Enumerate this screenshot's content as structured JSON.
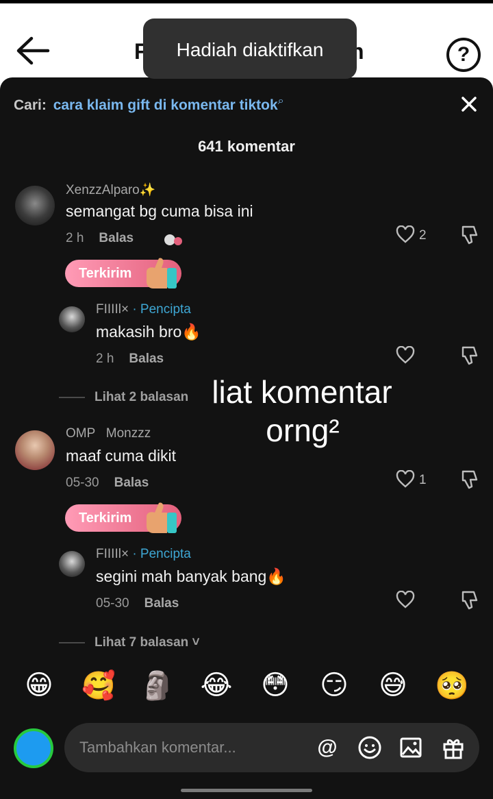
{
  "header": {
    "title_left_fragment": "F",
    "title_right_fragment": "n"
  },
  "toast": {
    "text": "Hadiah diaktifkan"
  },
  "search": {
    "prefix": "Cari:",
    "query": "cara klaim gift di komentar tiktok"
  },
  "comment_count": "641 komentar",
  "comments": [
    {
      "username": "XenzzAlparo✨",
      "text": "semangat bg  cuma bisa ini",
      "time": "2 h",
      "reply_label": "Balas",
      "likes": "2",
      "gift_label": "Terkirim"
    },
    {
      "username": "FIIIIl×",
      "creator_tag": "· Pencipta",
      "text": "makasih bro🔥",
      "time": "2 h",
      "reply_label": "Balas",
      "likes": ""
    },
    {
      "username": "OMP   Monzzz",
      "text": "maaf cuma dikit",
      "time": "05-30",
      "reply_label": "Balas",
      "likes": "1",
      "gift_label": "Terkirim"
    },
    {
      "username": "FIIIIl×",
      "creator_tag": "· Pencipta",
      "text": "segini mah banyak bang🔥",
      "time": "05-30",
      "reply_label": "Balas",
      "likes": ""
    }
  ],
  "view_replies": [
    "Lihat 2 balasan",
    "Lihat 7 balasan ˅"
  ],
  "overlay_text": {
    "line1": "liat komentar",
    "line2": "orng²"
  },
  "emoji_bar": [
    "😁",
    "🥰",
    "🗿",
    "😂",
    "😳",
    "😏",
    "😅",
    "🥺"
  ],
  "composer": {
    "placeholder": "Tambahkan komentar...",
    "mention_symbol": "@"
  },
  "icons": [
    "back-arrow-icon",
    "help-icon",
    "search-icon",
    "close-icon",
    "heart-icon",
    "dislike-icon",
    "thumbs-up-icon",
    "emoji-icon",
    "image-icon",
    "gift-icon"
  ],
  "colors": {
    "sheet_bg": "#121212",
    "link_blue": "#7ab8ef",
    "creator_blue": "#3ea7d4",
    "gift_pink": "#e3607c"
  }
}
